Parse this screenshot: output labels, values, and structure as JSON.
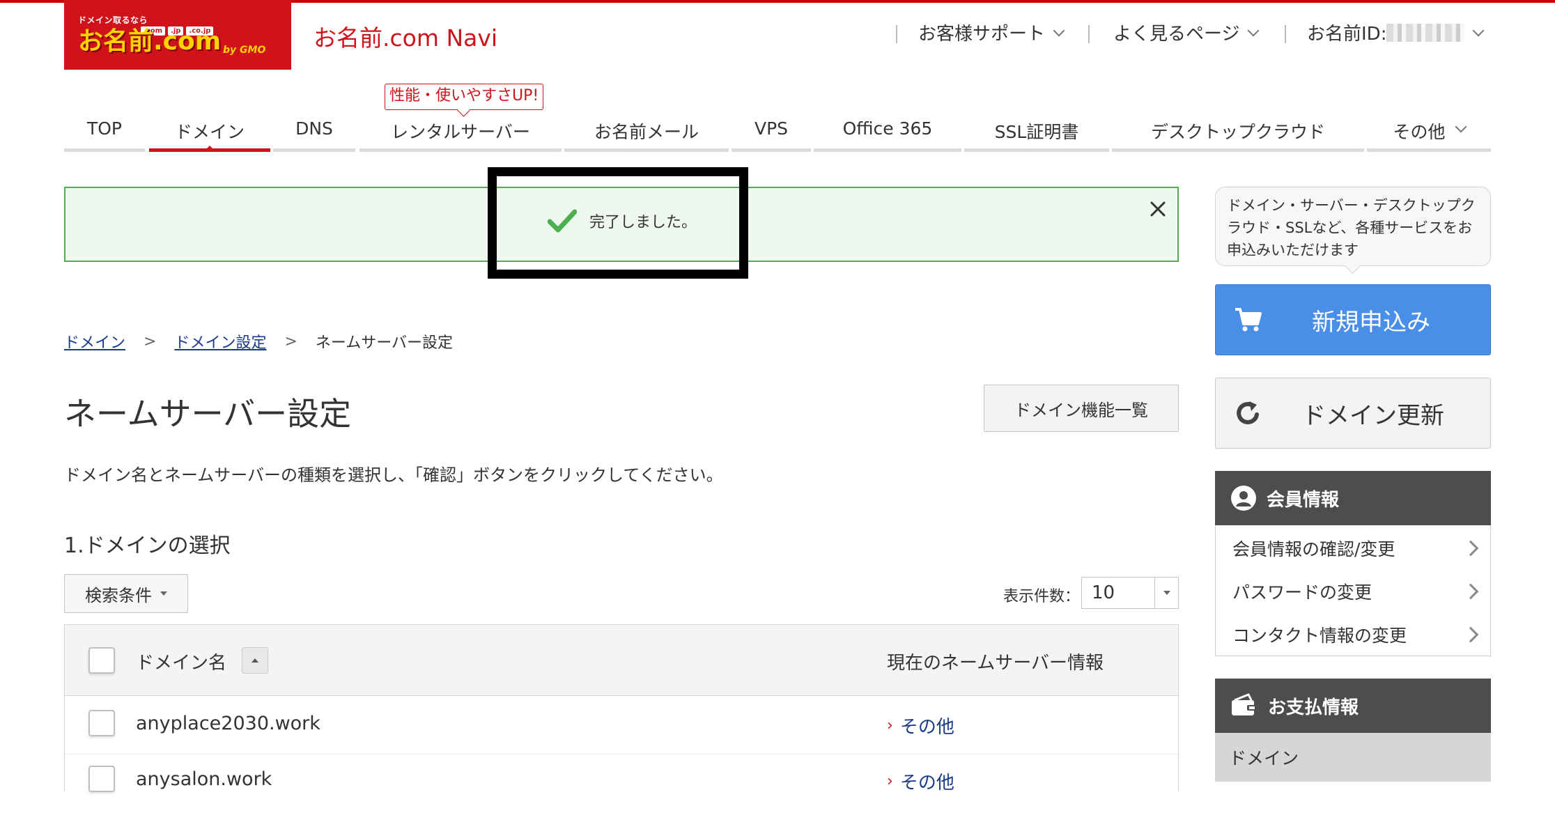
{
  "brand": {
    "logo_tagline": "ドメイン取るなら",
    "logo_tlds": [
      ".com",
      ".jp",
      ".co.jp"
    ],
    "logo_text": "お名前.com",
    "logo_by": "by GMO",
    "app_title": "お名前.com Navi",
    "accent_color": "#d0121b"
  },
  "header": {
    "support": "お客様サポート",
    "frequent": "よく見るページ",
    "account_label": "お名前ID:"
  },
  "nav": {
    "badge": "性能・使いやすさUP!",
    "items": [
      "TOP",
      "ドメイン",
      "DNS",
      "レンタルサーバー",
      "お名前メール",
      "VPS",
      "Office 365",
      "SSL証明書",
      "デスクトップクラウド",
      "その他"
    ],
    "active": "ドメイン"
  },
  "alert": {
    "message": "完了しました。",
    "color": "#4caf50"
  },
  "breadcrumb": [
    "ドメイン",
    "ドメイン設定",
    "ネームサーバー設定"
  ],
  "page": {
    "title": "ネームサーバー設定",
    "func_button": "ドメイン機能一覧",
    "description": "ドメイン名とネームサーバーの種類を選択し、「確認」ボタンをクリックしてください。",
    "section_title": "1.ドメインの選択",
    "search_button": "検索条件",
    "count_label": "表示件数：",
    "count_value": "10"
  },
  "table": {
    "col_domain": "ドメイン名",
    "col_ns": "現在のネームサーバー情報",
    "rows": [
      {
        "domain": "anyplace2030.work",
        "ns": "その他"
      },
      {
        "domain": "anysalon.work",
        "ns": "その他"
      }
    ]
  },
  "sidebar": {
    "bubble": "ドメイン・サーバー・デスクトップクラウド・SSLなど、各種サービスをお申込みいただけます",
    "new_button": "新規申込み",
    "renew_button": "ドメイン更新",
    "member_title": "会員情報",
    "member_links": [
      "会員情報の確認/変更",
      "パスワードの変更",
      "コンタクト情報の変更"
    ],
    "payment_title": "お支払情報",
    "payment_item": "ドメイン",
    "new_button_color": "#4a8fe7"
  }
}
